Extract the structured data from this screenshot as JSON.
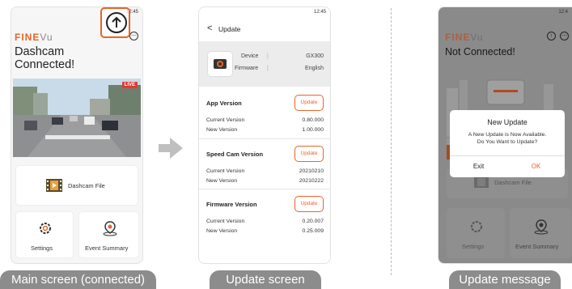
{
  "screens": [
    {
      "caption": "Main screen (connected)",
      "status_time": "12:45",
      "logo_part1": "FINE",
      "logo_part2": "Vu",
      "headline_1": "Dashcam",
      "headline_2": "Connected!",
      "live_badge": "LIVE",
      "dashcam_file_label": "Dashcam File",
      "settings_label": "Settings",
      "event_summary_label": "Event Summary"
    },
    {
      "caption": "Update screen",
      "status_time": "12:45",
      "back_glyph": "<",
      "title": "Update",
      "device_label": "Device",
      "device_value": "GX300",
      "firmware_label": "Firmware",
      "firmware_value": "English",
      "sections": [
        {
          "title": "App Version",
          "button": "Update",
          "current_label": "Current Version",
          "current_value": "0.80.000",
          "new_label": "New Version",
          "new_value": "1.00.000"
        },
        {
          "title": "Speed Cam Version",
          "button": "Update",
          "current_label": "Current Version",
          "current_value": "20210210",
          "new_label": "New Version",
          "new_value": "20210222"
        },
        {
          "title": "Firmware Version",
          "button": "Update",
          "current_label": "Current Version",
          "current_value": "0.20.007",
          "new_label": "New Version",
          "new_value": "0.25.009"
        }
      ]
    },
    {
      "caption": "Update message",
      "status_time": "12:4",
      "logo_part1": "FINE",
      "logo_part2": "Vu",
      "headline": "Not Connected!",
      "dashcam_file_label": "Dashcam File",
      "settings_label": "Settings",
      "event_summary_label": "Event Summary",
      "dialog": {
        "title": "New Update",
        "line1": "A New Update is Now Available.",
        "line2": "Do You Want to Update?",
        "exit": "Exit",
        "ok": "OK"
      }
    }
  ],
  "colors": {
    "accent": "#e8642a",
    "live": "#e53935",
    "overlay": "#8a8a8a"
  }
}
